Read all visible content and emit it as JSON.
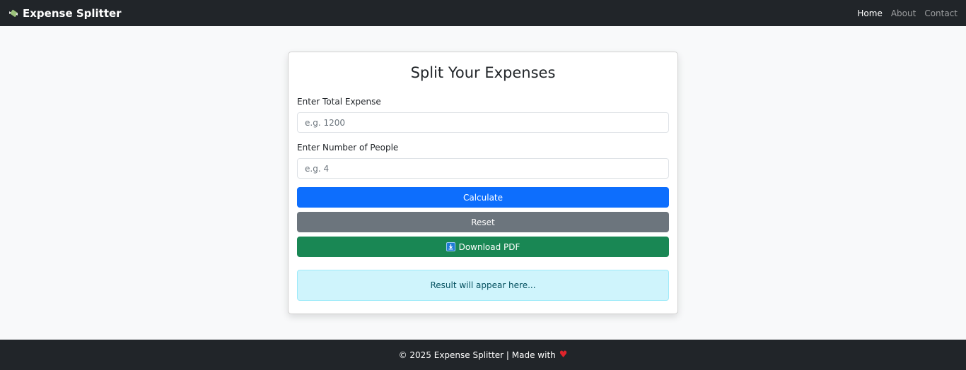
{
  "navbar": {
    "brand": "Expense Splitter",
    "brand_icon": "money-wings-icon",
    "links": [
      {
        "label": "Home",
        "active": true
      },
      {
        "label": "About",
        "active": false
      },
      {
        "label": "Contact",
        "active": false
      }
    ]
  },
  "form": {
    "title": "Split Your Expenses",
    "total_label": "Enter Total Expense",
    "total_placeholder": "e.g. 1200",
    "total_value": "",
    "people_label": "Enter Number of People",
    "people_placeholder": "e.g. 4",
    "people_value": "",
    "calculate_label": "Calculate",
    "reset_label": "Reset",
    "download_label": "Download PDF",
    "download_icon": "download-icon",
    "result_text": "Result will appear here..."
  },
  "footer": {
    "text": "© 2025 Expense Splitter | Made with",
    "heart_icon": "heart-icon"
  },
  "colors": {
    "navbar_bg": "#212529",
    "primary": "#0d6efd",
    "secondary": "#6c757d",
    "success": "#198754",
    "info_bg": "#cff4fc",
    "heart": "#e0242b"
  }
}
